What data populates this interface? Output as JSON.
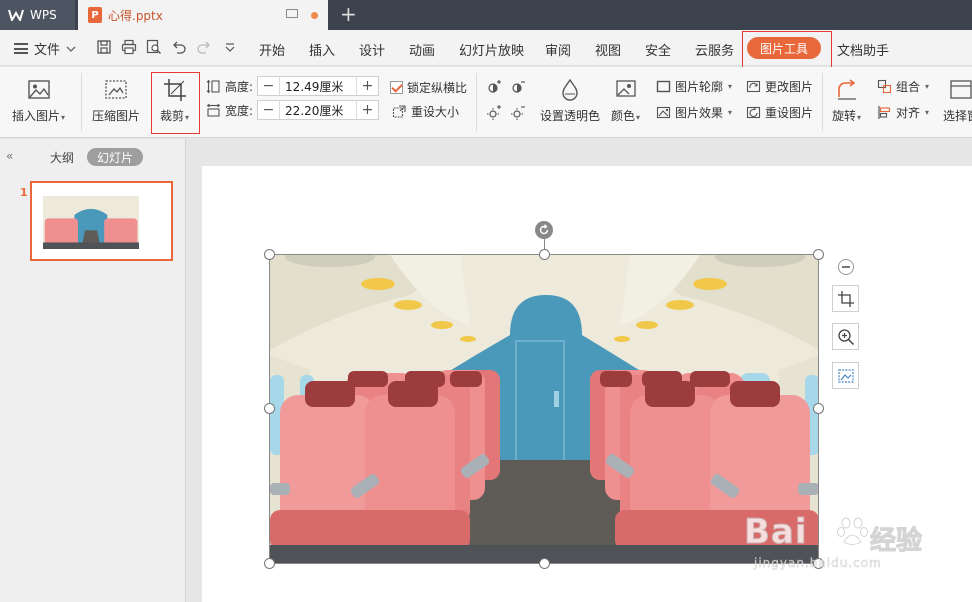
{
  "titlebar": {
    "app_name": "WPS",
    "document_tab": "心得.pptx",
    "new_tab": "+"
  },
  "menu": {
    "file": "文件",
    "tabs": [
      "开始",
      "插入",
      "设计",
      "动画",
      "幻灯片放映",
      "审阅",
      "视图",
      "安全",
      "云服务"
    ],
    "active_tab": "图片工具",
    "assistant_tab": "文档助手"
  },
  "ribbon": {
    "insert_picture": "插入图片",
    "compress_picture": "压缩图片",
    "crop": "裁剪",
    "height_label": "高度:",
    "height_value": "12.49厘米",
    "width_label": "宽度:",
    "width_value": "22.20厘米",
    "lock_ratio": "锁定纵横比",
    "lock_ratio_checked": true,
    "reset_size": "重设大小",
    "set_transparent": "设置透明色",
    "color": "颜色",
    "picture_outline": "图片轮廓",
    "picture_effects": "图片效果",
    "change_picture": "更改图片",
    "reset_picture": "重设图片",
    "rotate": "旋转",
    "group": "组合",
    "align": "对齐",
    "selection_pane": "选择窗"
  },
  "left_panel": {
    "collapse": "«",
    "tab_outline": "大纲",
    "tab_slides": "幻灯片",
    "slide_number": "1"
  },
  "watermark": {
    "brand": "Bai",
    "brand_suffix": "经验",
    "url": "jingyan.baidu.com"
  },
  "colors": {
    "accent": "#e8673b",
    "highlight_box": "#e53935",
    "titlebar": "#3c424e"
  }
}
